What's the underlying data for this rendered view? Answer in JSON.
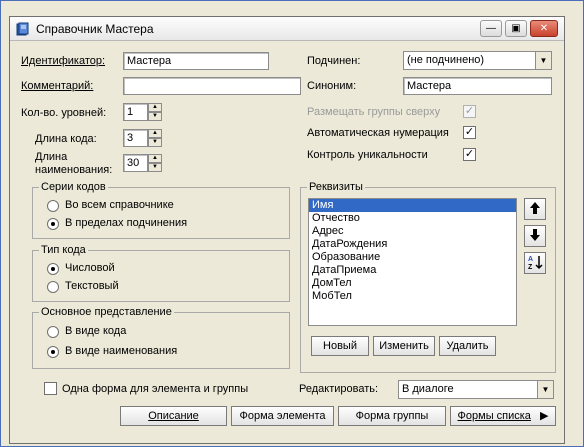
{
  "window": {
    "title": "Справочник Мастера",
    "minimize": "—",
    "maximize": "▣",
    "close": "✕"
  },
  "fields": {
    "identifier_label": "Идентификатор:",
    "identifier_value": "Мастера",
    "comment_label": "Комментарий:",
    "comment_value": "",
    "levels_label": "Кол-во. уровней:",
    "levels_value": "1",
    "code_length_label": "Длина кода:",
    "code_length_value": "3",
    "name_length_label_1": "Длина",
    "name_length_label_2": "наименования:",
    "name_length_value": "30",
    "subordinate_label": "Подчинен:",
    "subordinate_value": "(не подчинено)",
    "synonym_label": "Синоним:",
    "synonym_value": "Мастера",
    "groups_top_label": "Размещать группы сверху",
    "groups_top_checked": true,
    "auto_number_label": "Автоматическая нумерация",
    "auto_number_checked": true,
    "uniqueness_label": "Контроль уникальности",
    "uniqueness_checked": true
  },
  "code_series": {
    "title": "Серии кодов",
    "options": [
      {
        "label": "Во всем справочнике",
        "selected": false
      },
      {
        "label": "В пределах подчинения",
        "selected": true
      }
    ]
  },
  "code_type": {
    "title": "Тип кода",
    "options": [
      {
        "label": "Числовой",
        "selected": true
      },
      {
        "label": "Текстовый",
        "selected": false
      }
    ]
  },
  "main_view": {
    "title": "Основное представление",
    "options": [
      {
        "label": "В виде кода",
        "selected": false
      },
      {
        "label": "В виде наименования",
        "selected": true
      }
    ]
  },
  "attributes": {
    "title": "Реквизиты",
    "items": [
      "Имя",
      "Отчество",
      "Адрес",
      "ДатаРождения",
      "Образование",
      "ДатаПриема",
      "ДомТел",
      "МобТел"
    ],
    "selected_index": 0,
    "new_button": "Новый",
    "edit_button": "Изменить",
    "delete_button": "Удалить"
  },
  "footer": {
    "single_form_label": "Одна форма для элемента и группы",
    "single_form_checked": false,
    "edit_label": "Редактировать:",
    "edit_value": "В диалоге",
    "description_button": "Описание",
    "element_form_button": "Форма элемента",
    "group_form_button": "Форма группы",
    "list_forms_button": "Формы списка"
  }
}
